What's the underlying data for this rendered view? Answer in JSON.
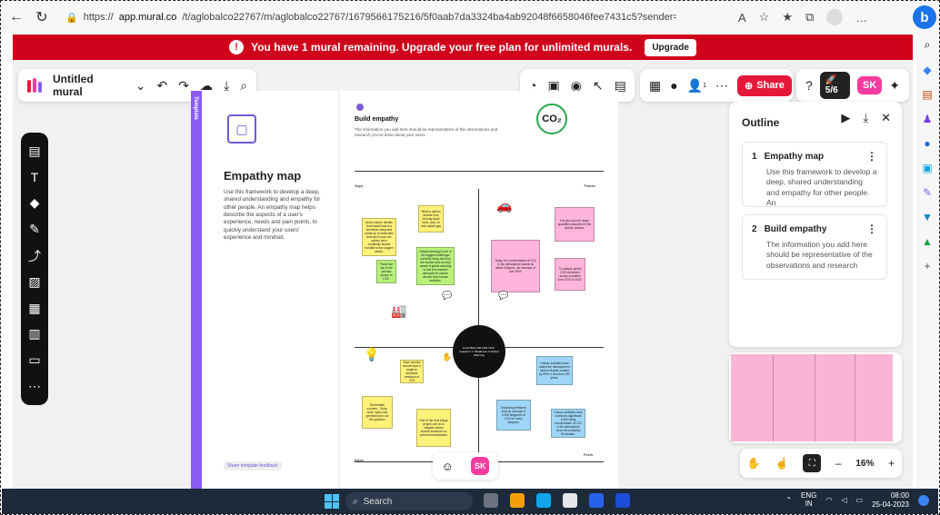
{
  "browser": {
    "url_prefix": "https://",
    "url_host": "app.mural.co",
    "url_path": "/t/aglobalco22767/m/aglobalco22767/1679566175216/5f0aab7da3324ba4ab92048f6658046fee7431c5?sender=ucf156caede639dd8053c8015",
    "icons": [
      "back-icon",
      "refresh-icon",
      "lock-icon",
      "read-aloud-icon",
      "favorite-icon",
      "favorites-icon",
      "collections-icon",
      "profile-icon",
      "more-icon"
    ]
  },
  "banner": {
    "message": "You have 1 mural remaining. Upgrade your free plan for unlimited murals.",
    "button": "Upgrade",
    "color": "#d0021b"
  },
  "toolbar": {
    "title": "Untitled mural",
    "share_label": "Share",
    "progress_label": "5/6",
    "avatar_initials": "SK",
    "notification_count": "1"
  },
  "template_panel": {
    "tab_label": "Template",
    "heading": "Empathy map",
    "description": "Use this framework to develop a deep, shared understanding and empathy for other people. An empathy map helps describe the aspects of a user's experience, needs and pain points, to quickly understand your users' experience and mindset.",
    "feedback_label": "Share template feedback"
  },
  "board": {
    "heading": "Build empathy",
    "description": "The information you add here should be representative of the observations and research you've done about your users.",
    "co2_label": "CO₂",
    "quadrants": {
      "says": "Says",
      "thinks": "Thinks",
      "does": "Does",
      "feels": "Feels"
    },
    "center_text": "A GLOBAL AIM FOR CO2 · Question 1: Weakness of Global Warming",
    "notes": [
      {
        "text": "What is carbon dioxide from burning fossil fuels: coal, oil and natural gas",
        "color": "y"
      },
      {
        "text": "About carbon dioxide from fossil fuels is a chemical compound made up of molecules that each have one carbon atom covalently double bonded to two oxygen atoms.",
        "color": "y"
      },
      {
        "text": "Fossil fuel use is the primary source of CO2.",
        "color": "g"
      },
      {
        "text": "Global warming is one of the biggest challenges currently being faced by the human race as they cause of global warming is due to increased atmospheric carbon dioxide from human activities.",
        "color": "g"
      },
      {
        "text": "Today, the concentration of CO2 in the atmosphere stands at about 316ppm—an increase of over 30%.",
        "color": "p"
      },
      {
        "text": "It is also found in large quantities dissolved in the world's oceans.",
        "color": "p"
      },
      {
        "text": "To analyze global CO2 emissions across countries from 1970 to 2020.",
        "color": "p"
      },
      {
        "text": "Each country should have a target to decrease emission of CO2",
        "color": "y"
      },
      {
        "text": "Renewable sources... Solar, wind, hydro and geothermal to cut the pollution",
        "color": "y"
      },
      {
        "text": "One of the best things people can do to mitigate carbon dioxide emissions to prevent deforestation",
        "color": "y"
      },
      {
        "text": "Human activities have raised the atmosphere's carbon dioxide content by 50% in less than 200 years.",
        "color": "b"
      },
      {
        "text": "Dissolving fertilizers emit an average of 0.225 kilograms of CO2 for every kilogram.",
        "color": "b"
      },
      {
        "text": "Human activities have continued significant to the rising concentration of CO2 in the atmosphere since the Industrial Revolution.",
        "color": "b"
      }
    ]
  },
  "bottom_center": {
    "avatar_initials": "SK"
  },
  "outline": {
    "title": "Outline",
    "items": [
      {
        "number": "1",
        "title": "Empathy map",
        "description": "Use this framework to develop a deep, shared understanding and empathy for other people. An"
      },
      {
        "number": "2",
        "title": "Build empathy",
        "description": "The information you add here should be representative of the observations and research"
      }
    ]
  },
  "zoom": {
    "value": "16%",
    "minus": "–",
    "plus": "+"
  },
  "taskbar": {
    "search_label": "Search",
    "lang_primary": "ENG",
    "lang_secondary": "IN",
    "time": "08:00",
    "date": "25-04-2023"
  }
}
